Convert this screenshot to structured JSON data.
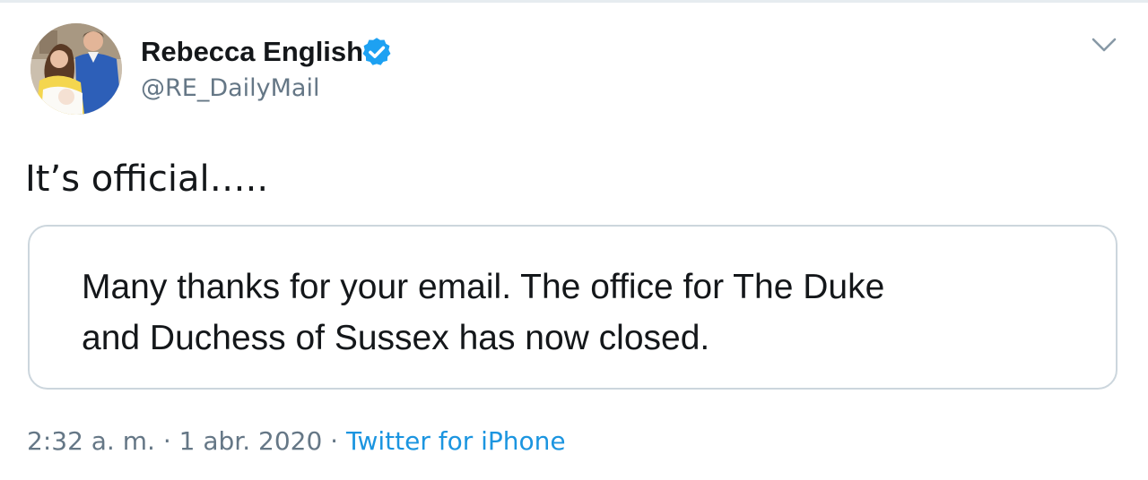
{
  "author": {
    "name": "Rebecca English",
    "handle": "@RE_DailyMail",
    "verified": true
  },
  "tweet": {
    "text": "It’s official….."
  },
  "quote_card": {
    "line1": "Many thanks for your email. The office for The Duke",
    "line2": "and Duchess of Sussex has now closed."
  },
  "meta": {
    "time": "2:32 a. m.",
    "separator1": " · ",
    "date": "1 abr. 2020",
    "separator2": " · ",
    "source": "Twitter for iPhone"
  },
  "icons": {
    "verified": "verified-badge-icon",
    "menu": "chevron-down-icon"
  },
  "colors": {
    "text": "#14171a",
    "secondary": "#657786",
    "link": "#1b95e0",
    "verified": "#1da1f2",
    "border": "#ccd6dd"
  }
}
